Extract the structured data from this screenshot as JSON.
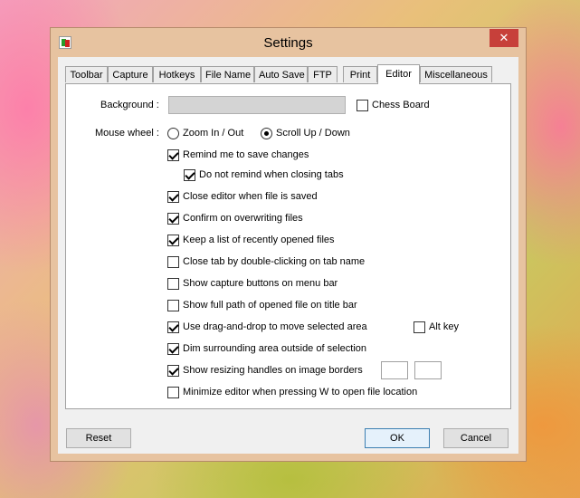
{
  "window": {
    "title": "Settings",
    "close_glyph": "✕"
  },
  "tabs": [
    {
      "label": "Toolbar"
    },
    {
      "label": "Capture"
    },
    {
      "label": "Hotkeys"
    },
    {
      "label": "File Name"
    },
    {
      "label": "Auto Save"
    },
    {
      "label": "FTP"
    },
    {
      "label": "Print"
    },
    {
      "label": "Editor",
      "active": true
    },
    {
      "label": "Miscellaneous"
    }
  ],
  "editor": {
    "background_label": "Background :",
    "chess_board_label": "Chess Board",
    "chess_board_checked": false,
    "mouse_wheel_label": "Mouse wheel :",
    "zoom_label": "Zoom In / Out",
    "scroll_label": "Scroll Up / Down",
    "mouse_wheel_selected": "scroll",
    "options": [
      {
        "label": "Remind me to save changes",
        "checked": true
      },
      {
        "label": "Do not remind when closing tabs",
        "checked": true
      },
      {
        "label": "Close editor when file is saved",
        "checked": true
      },
      {
        "label": "Confirm on overwriting files",
        "checked": true
      },
      {
        "label": "Keep a list of recently opened files",
        "checked": true
      },
      {
        "label": "Close tab by double-clicking on tab name",
        "checked": false
      },
      {
        "label": "Show capture buttons on menu bar",
        "checked": false
      },
      {
        "label": "Show full path of opened file on title bar",
        "checked": false
      },
      {
        "label": "Use drag-and-drop to move selected area",
        "checked": true
      },
      {
        "label": "Dim surrounding area outside of selection",
        "checked": true
      },
      {
        "label": "Show resizing handles on image borders",
        "checked": true
      },
      {
        "label": "Minimize editor when pressing W to open file location",
        "checked": false
      }
    ],
    "alt_key_label": "Alt key",
    "alt_key_checked": false
  },
  "buttons": {
    "reset": "Reset",
    "ok": "OK",
    "cancel": "Cancel"
  }
}
